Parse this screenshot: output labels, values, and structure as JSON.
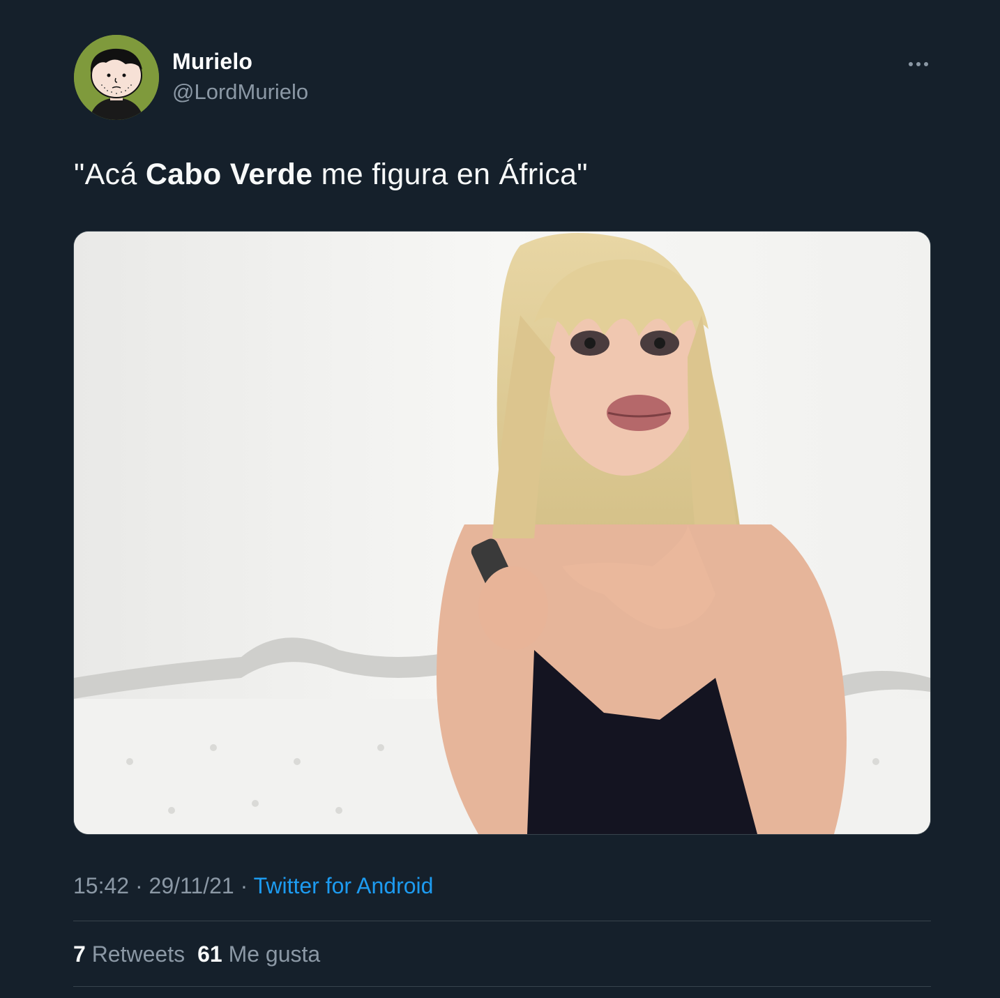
{
  "author": {
    "display_name": "Murielo",
    "handle": "@LordMurielo"
  },
  "tweet": {
    "text_before": "\"Acá ",
    "text_bold": "Cabo Verde",
    "text_after": " me figura en África\""
  },
  "media": {
    "icon": "meme-photo"
  },
  "meta": {
    "time": "15:42",
    "separator": "·",
    "date": "29/11/21",
    "source": "Twitter for Android"
  },
  "stats": {
    "retweets_count": "7",
    "retweets_label": "Retweets",
    "likes_count": "61",
    "likes_label": "Me gusta"
  },
  "colors": {
    "background": "#15202b",
    "text_primary": "#f7f9f9",
    "text_secondary": "#8b98a5",
    "link": "#1d9bf0",
    "divider": "#38444d"
  }
}
